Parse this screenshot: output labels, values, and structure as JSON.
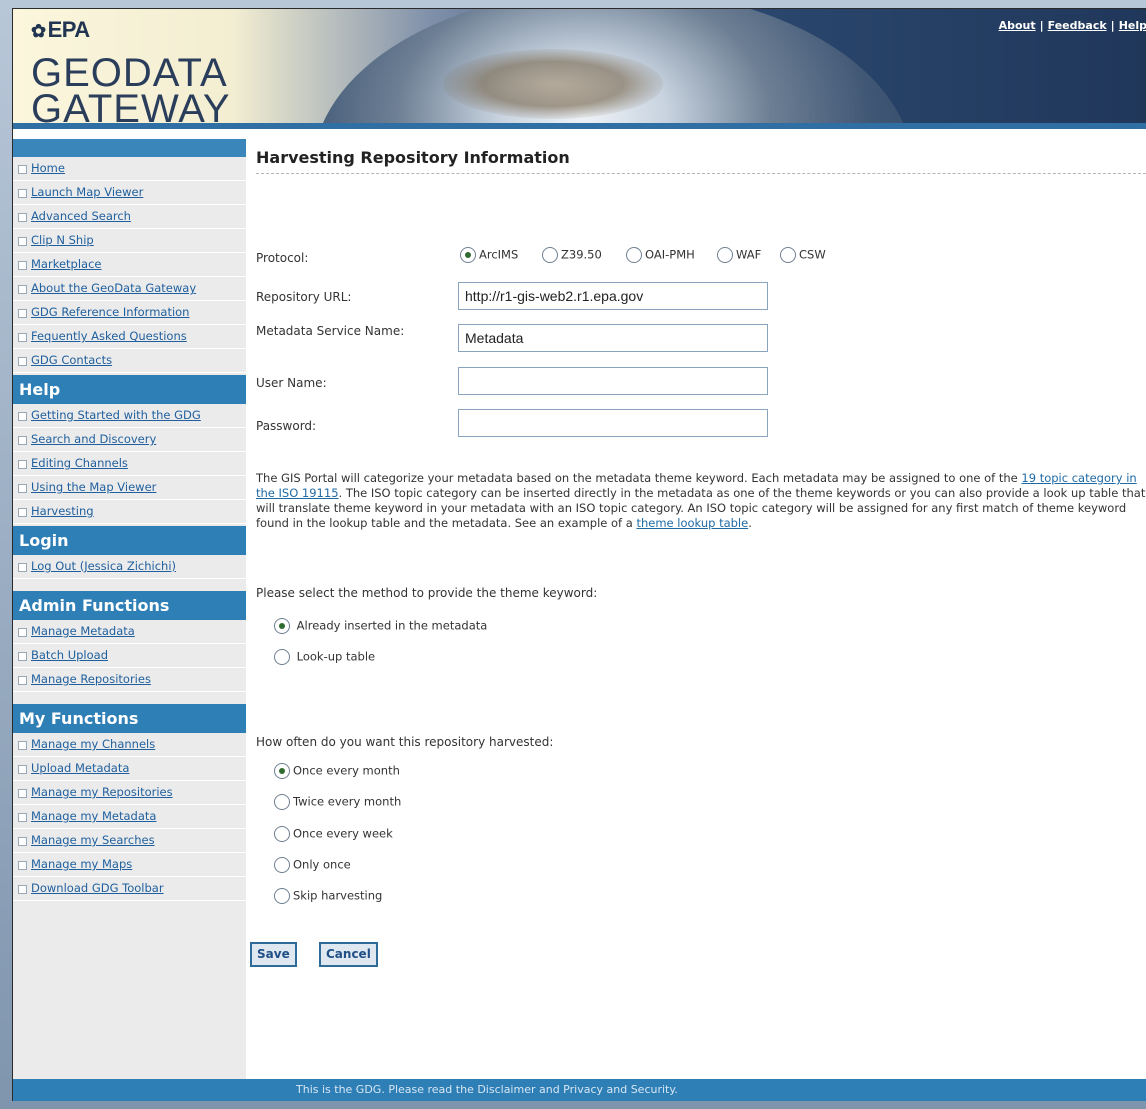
{
  "header": {
    "agency": "EPA",
    "title_line1": "GEODATA",
    "title_line2": "GATEWAY",
    "links": [
      "About",
      "Feedback",
      "Help"
    ]
  },
  "sidebar": {
    "nav": [
      {
        "label": "Home"
      },
      {
        "label": "Launch Map Viewer"
      },
      {
        "label": "Advanced Search"
      },
      {
        "label": "Clip N Ship"
      },
      {
        "label": "Marketplace"
      },
      {
        "label": "About the GeoData Gateway"
      },
      {
        "label": "GDG Reference Information"
      },
      {
        "label": "Fequently Asked Questions"
      },
      {
        "label": "GDG Contacts"
      }
    ],
    "help_heading": "Help",
    "help": [
      {
        "label": "Getting Started with the GDG"
      },
      {
        "label": "Search and Discovery"
      },
      {
        "label": "Editing Channels"
      },
      {
        "label": "Using the Map Viewer"
      },
      {
        "label": "Harvesting"
      }
    ],
    "login_heading": "Login",
    "login": [
      {
        "label": "Log Out (Jessica Zichichi)"
      }
    ],
    "admin_heading": "Admin Functions",
    "admin": [
      {
        "label": "Manage Metadata"
      },
      {
        "label": "Batch Upload"
      },
      {
        "label": "Manage Repositories"
      }
    ],
    "my_heading": "My Functions",
    "my": [
      {
        "label": "Manage my Channels"
      },
      {
        "label": "Upload Metadata"
      },
      {
        "label": "Manage my Repositories"
      },
      {
        "label": "Manage my Metadata"
      },
      {
        "label": "Manage my Searches"
      },
      {
        "label": "Manage my Maps"
      },
      {
        "label": "Download GDG Toolbar"
      }
    ]
  },
  "main": {
    "title": "Harvesting Repository Information",
    "protocol": {
      "label": "Protocol:",
      "options": [
        "ArcIMS",
        "Z39.50",
        "OAI-PMH",
        "WAF",
        "CSW"
      ],
      "selected": "ArcIMS"
    },
    "repository_url": {
      "label": "Repository URL:",
      "value": "http://r1-gis-web2.r1.epa.gov"
    },
    "metadata_service": {
      "label": "Metadata Service Name:",
      "value": "Metadata"
    },
    "user_name": {
      "label": "User Name:",
      "value": ""
    },
    "password": {
      "label": "Password:",
      "value": ""
    },
    "paragraph": {
      "text1": "The GIS Portal will categorize your metadata based on the metadata theme keyword. Each metadata may be assigned to one of the ",
      "link1": "19 topic category in the ISO 19115",
      "text2": ". The ISO topic category can be inserted directly in the metadata as one of the theme keywords or you can also provide a look up table that will translate theme keyword in your metadata with an ISO topic category. An ISO topic category will be assigned for any first match of theme keyword found in the lookup table and the metadata. See an example of a ",
      "link2": "theme lookup table",
      "text3": "."
    },
    "method": {
      "prompt": "Please select the method to provide the theme keyword:",
      "options": [
        "Already inserted in the metadata",
        "Look-up table"
      ],
      "selected": "Already inserted in the metadata"
    },
    "frequency": {
      "prompt": "How often do you want this repository harvested:",
      "options": [
        "Once every month",
        "Twice every month",
        "Once every week",
        "Only once",
        "Skip harvesting"
      ],
      "selected": "Once every month"
    },
    "save_label": "Save",
    "cancel_label": "Cancel"
  },
  "footer": {
    "text": "This is the GDG. Please read the Disclaimer and Privacy and Security."
  }
}
